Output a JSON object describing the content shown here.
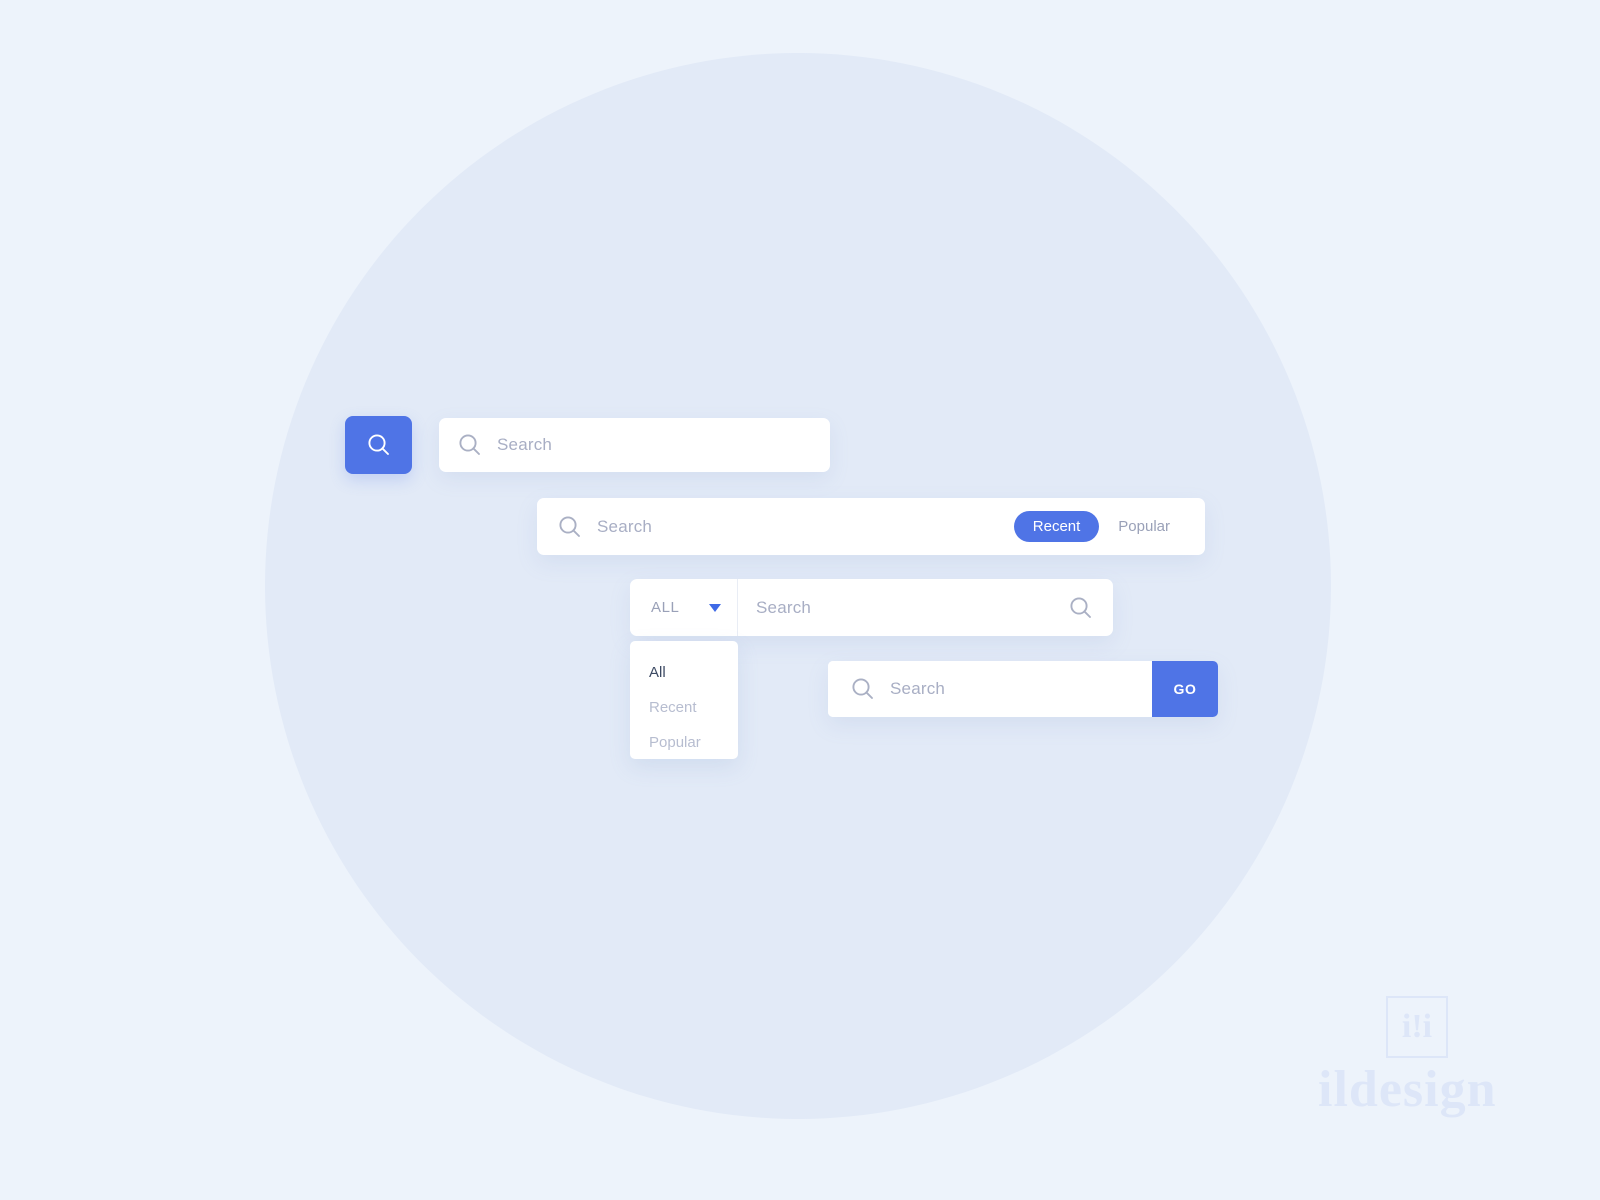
{
  "canvas": {
    "background_color": "#edf3fb",
    "circle_color": "#e2eaf7",
    "accent_color": "#4f74e6",
    "placeholder_color": "#a8aec4"
  },
  "search_icon_button": {
    "icon": "search-icon",
    "aria_label": "Search"
  },
  "bar_simple": {
    "icon": "search-icon",
    "placeholder": "Search",
    "value": ""
  },
  "bar_with_filters": {
    "icon": "search-icon",
    "placeholder": "Search",
    "value": "",
    "filters": [
      {
        "label": "Recent",
        "active": true
      },
      {
        "label": "Popular",
        "active": false
      }
    ]
  },
  "bar_with_select": {
    "select_label": "ALL",
    "caret_icon": "chevron-down-icon",
    "placeholder": "Search",
    "value": "",
    "trailing_icon": "search-icon"
  },
  "dropdown": {
    "items": [
      {
        "label": "All",
        "selected": true
      },
      {
        "label": "Recent",
        "selected": false
      },
      {
        "label": "Popular",
        "selected": false
      }
    ]
  },
  "bar_with_go": {
    "icon": "search-icon",
    "placeholder": "Search",
    "value": "",
    "button_label": "GO"
  },
  "watermark": {
    "logo_mark": "i!i",
    "wordmark": "ildesign"
  }
}
